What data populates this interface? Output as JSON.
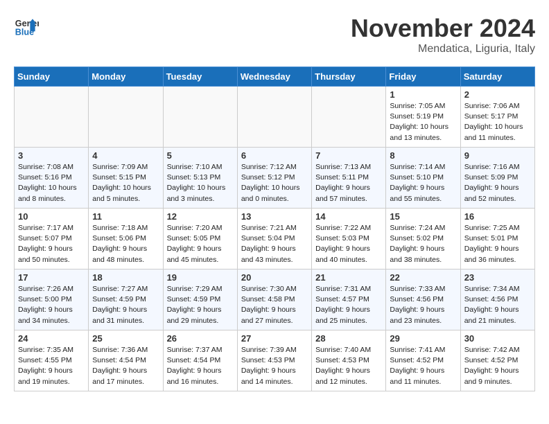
{
  "header": {
    "logo_line1": "General",
    "logo_line2": "Blue",
    "month": "November 2024",
    "location": "Mendatica, Liguria, Italy"
  },
  "weekdays": [
    "Sunday",
    "Monday",
    "Tuesday",
    "Wednesday",
    "Thursday",
    "Friday",
    "Saturday"
  ],
  "weeks": [
    [
      {
        "day": "",
        "info": ""
      },
      {
        "day": "",
        "info": ""
      },
      {
        "day": "",
        "info": ""
      },
      {
        "day": "",
        "info": ""
      },
      {
        "day": "",
        "info": ""
      },
      {
        "day": "1",
        "info": "Sunrise: 7:05 AM\nSunset: 5:19 PM\nDaylight: 10 hours and 13 minutes."
      },
      {
        "day": "2",
        "info": "Sunrise: 7:06 AM\nSunset: 5:17 PM\nDaylight: 10 hours and 11 minutes."
      }
    ],
    [
      {
        "day": "3",
        "info": "Sunrise: 7:08 AM\nSunset: 5:16 PM\nDaylight: 10 hours and 8 minutes."
      },
      {
        "day": "4",
        "info": "Sunrise: 7:09 AM\nSunset: 5:15 PM\nDaylight: 10 hours and 5 minutes."
      },
      {
        "day": "5",
        "info": "Sunrise: 7:10 AM\nSunset: 5:13 PM\nDaylight: 10 hours and 3 minutes."
      },
      {
        "day": "6",
        "info": "Sunrise: 7:12 AM\nSunset: 5:12 PM\nDaylight: 10 hours and 0 minutes."
      },
      {
        "day": "7",
        "info": "Sunrise: 7:13 AM\nSunset: 5:11 PM\nDaylight: 9 hours and 57 minutes."
      },
      {
        "day": "8",
        "info": "Sunrise: 7:14 AM\nSunset: 5:10 PM\nDaylight: 9 hours and 55 minutes."
      },
      {
        "day": "9",
        "info": "Sunrise: 7:16 AM\nSunset: 5:09 PM\nDaylight: 9 hours and 52 minutes."
      }
    ],
    [
      {
        "day": "10",
        "info": "Sunrise: 7:17 AM\nSunset: 5:07 PM\nDaylight: 9 hours and 50 minutes."
      },
      {
        "day": "11",
        "info": "Sunrise: 7:18 AM\nSunset: 5:06 PM\nDaylight: 9 hours and 48 minutes."
      },
      {
        "day": "12",
        "info": "Sunrise: 7:20 AM\nSunset: 5:05 PM\nDaylight: 9 hours and 45 minutes."
      },
      {
        "day": "13",
        "info": "Sunrise: 7:21 AM\nSunset: 5:04 PM\nDaylight: 9 hours and 43 minutes."
      },
      {
        "day": "14",
        "info": "Sunrise: 7:22 AM\nSunset: 5:03 PM\nDaylight: 9 hours and 40 minutes."
      },
      {
        "day": "15",
        "info": "Sunrise: 7:24 AM\nSunset: 5:02 PM\nDaylight: 9 hours and 38 minutes."
      },
      {
        "day": "16",
        "info": "Sunrise: 7:25 AM\nSunset: 5:01 PM\nDaylight: 9 hours and 36 minutes."
      }
    ],
    [
      {
        "day": "17",
        "info": "Sunrise: 7:26 AM\nSunset: 5:00 PM\nDaylight: 9 hours and 34 minutes."
      },
      {
        "day": "18",
        "info": "Sunrise: 7:27 AM\nSunset: 4:59 PM\nDaylight: 9 hours and 31 minutes."
      },
      {
        "day": "19",
        "info": "Sunrise: 7:29 AM\nSunset: 4:59 PM\nDaylight: 9 hours and 29 minutes."
      },
      {
        "day": "20",
        "info": "Sunrise: 7:30 AM\nSunset: 4:58 PM\nDaylight: 9 hours and 27 minutes."
      },
      {
        "day": "21",
        "info": "Sunrise: 7:31 AM\nSunset: 4:57 PM\nDaylight: 9 hours and 25 minutes."
      },
      {
        "day": "22",
        "info": "Sunrise: 7:33 AM\nSunset: 4:56 PM\nDaylight: 9 hours and 23 minutes."
      },
      {
        "day": "23",
        "info": "Sunrise: 7:34 AM\nSunset: 4:56 PM\nDaylight: 9 hours and 21 minutes."
      }
    ],
    [
      {
        "day": "24",
        "info": "Sunrise: 7:35 AM\nSunset: 4:55 PM\nDaylight: 9 hours and 19 minutes."
      },
      {
        "day": "25",
        "info": "Sunrise: 7:36 AM\nSunset: 4:54 PM\nDaylight: 9 hours and 17 minutes."
      },
      {
        "day": "26",
        "info": "Sunrise: 7:37 AM\nSunset: 4:54 PM\nDaylight: 9 hours and 16 minutes."
      },
      {
        "day": "27",
        "info": "Sunrise: 7:39 AM\nSunset: 4:53 PM\nDaylight: 9 hours and 14 minutes."
      },
      {
        "day": "28",
        "info": "Sunrise: 7:40 AM\nSunset: 4:53 PM\nDaylight: 9 hours and 12 minutes."
      },
      {
        "day": "29",
        "info": "Sunrise: 7:41 AM\nSunset: 4:52 PM\nDaylight: 9 hours and 11 minutes."
      },
      {
        "day": "30",
        "info": "Sunrise: 7:42 AM\nSunset: 4:52 PM\nDaylight: 9 hours and 9 minutes."
      }
    ]
  ]
}
